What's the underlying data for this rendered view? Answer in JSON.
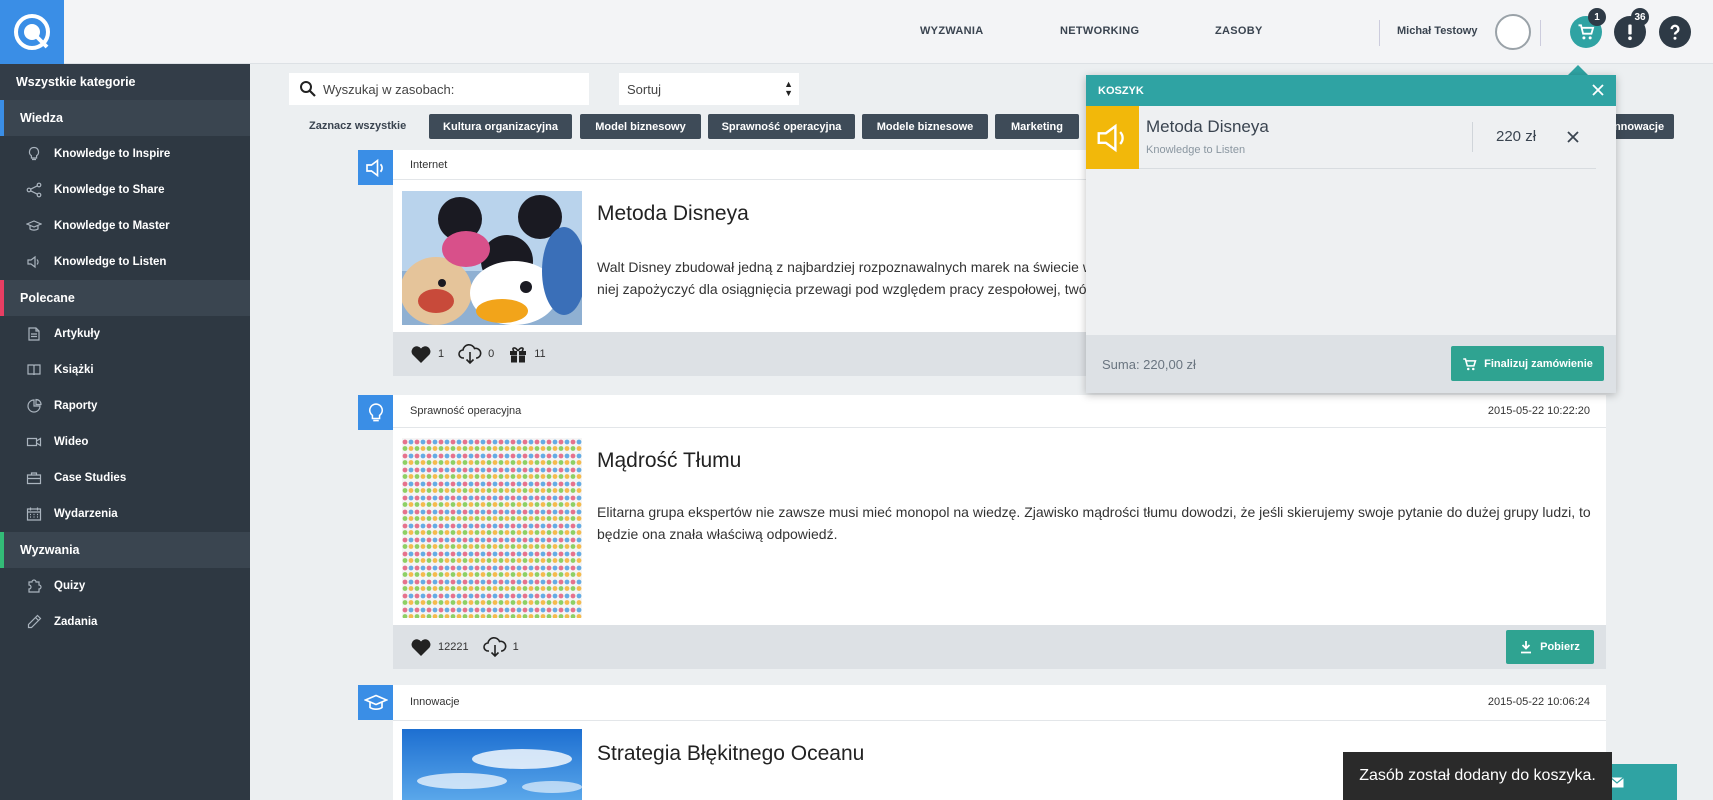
{
  "topbar": {
    "nav": [
      "WYZWANIA",
      "NETWORKING",
      "ZASOBY"
    ],
    "user_name": "Michał Testowy",
    "cart_badge": "1",
    "alerts_badge": "36",
    "colors": {
      "brand": "#3a8ee6",
      "teal": "#2fa3a3"
    }
  },
  "sidebar": {
    "all_categories": "Wszystkie kategorie",
    "sections": [
      {
        "label": "Wiedza",
        "accent": "#3a8ee6",
        "items": [
          {
            "label": "Knowledge to Inspire",
            "icon": "lightbulb-icon"
          },
          {
            "label": "Knowledge to Share",
            "icon": "share-icon"
          },
          {
            "label": "Knowledge to Master",
            "icon": "graduation-cap-icon"
          },
          {
            "label": "Knowledge to Listen",
            "icon": "speaker-icon"
          }
        ]
      },
      {
        "label": "Polecane",
        "accent": "#e83e63",
        "items": [
          {
            "label": "Artykuły",
            "icon": "document-icon"
          },
          {
            "label": "Książki",
            "icon": "book-icon"
          },
          {
            "label": "Raporty",
            "icon": "pie-chart-icon"
          },
          {
            "label": "Wideo",
            "icon": "video-camera-icon"
          },
          {
            "label": "Case Studies",
            "icon": "briefcase-icon"
          },
          {
            "label": "Wydarzenia",
            "icon": "calendar-icon"
          }
        ]
      },
      {
        "label": "Wyzwania",
        "accent": "#33bb77",
        "items": [
          {
            "label": "Quizy",
            "icon": "puzzle-icon"
          },
          {
            "label": "Zadania",
            "icon": "pencil-icon"
          }
        ]
      }
    ]
  },
  "toolbar": {
    "search_placeholder": "Wyszukaj w zasobach:",
    "sort_label": "Sortuj",
    "select_all": "Zaznacz wszystkie",
    "tags": [
      "Kultura organizacyjna",
      "Model biznesowy",
      "Sprawność operacyjna",
      "Modele biznesowe",
      "Marketing",
      "nnowacje"
    ]
  },
  "cards": [
    {
      "category": "Internet",
      "date": "",
      "title": "Metoda Disneya",
      "description": "Walt Disney zbudował jedną z najbardziej rozpoznawalnych marek na świecie w\nniej zapożyczyć dla osiągnięcia przewagi pod względem pracy zespołowej, twó",
      "likes": "1",
      "downloads": "0",
      "gifts": "11",
      "type_icon": "speaker-icon",
      "image": "mickey-donald-balloons"
    },
    {
      "category": "Sprawność operacyjna",
      "date": "2015-05-22 10:22:20",
      "title": "Mądrość Tłumu",
      "description": "Elitarna grupa ekspertów nie zawsze musi mieć monopol na wiedzę. Zjawisko mądrości tłumu dowodzi, że jeśli skierujemy swoje pytanie do dużej grupy ludzi, to będzie ona znała właściwą odpowiedź.",
      "likes": "12221",
      "downloads": "1",
      "download_label": "Pobierz",
      "type_icon": "lightbulb-icon",
      "image": "crowd-pattern"
    },
    {
      "category": "Innowacje",
      "date": "2015-05-22 10:06:24",
      "title": "Strategia Błękitnego Oceanu",
      "type_icon": "graduation-cap-icon",
      "image": "blue-sky"
    }
  ],
  "cart": {
    "header": "KOSZYK",
    "item_title": "Metoda Disneya",
    "item_sub": "Knowledge to Listen",
    "item_price": "220 zł",
    "sum": "Suma: 220,00 zł",
    "finalize": "Finalizuj zamówienie"
  },
  "toast": "Zasób został dodany do koszyka."
}
